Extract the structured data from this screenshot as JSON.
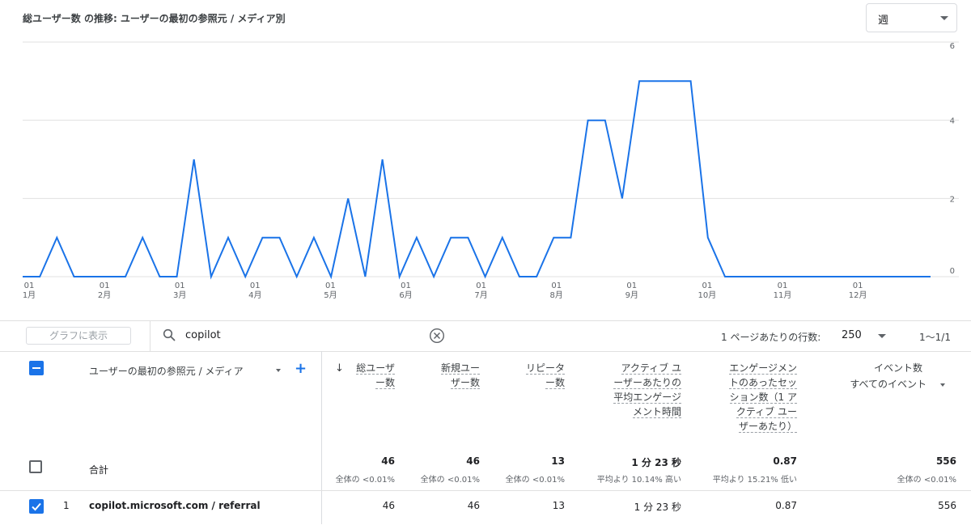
{
  "chart_title": "総ユーザー数 の推移: ユーザーの最初の参照元 / メディア別",
  "period_select": "週",
  "chart_data": {
    "type": "line",
    "y_ticks": [
      "6",
      "4",
      "2",
      "0"
    ],
    "ylim": [
      0,
      6
    ],
    "x_ticks": [
      {
        "day": "01",
        "month": "1月"
      },
      {
        "day": "01",
        "month": "2月"
      },
      {
        "day": "01",
        "month": "3月"
      },
      {
        "day": "01",
        "month": "4月"
      },
      {
        "day": "01",
        "month": "5月"
      },
      {
        "day": "01",
        "month": "6月"
      },
      {
        "day": "01",
        "month": "7月"
      },
      {
        "day": "01",
        "month": "8月"
      },
      {
        "day": "01",
        "month": "9月"
      },
      {
        "day": "01",
        "month": "10月"
      },
      {
        "day": "01",
        "month": "11月"
      },
      {
        "day": "01",
        "month": "12月"
      }
    ],
    "series": [
      {
        "color": "#1a73e8",
        "values": [
          0,
          0,
          1,
          0,
          0,
          0,
          0,
          1,
          0,
          0,
          3,
          0,
          1,
          0,
          1,
          1,
          0,
          1,
          0,
          2,
          0,
          3,
          0,
          1,
          0,
          1,
          1,
          0,
          1,
          0,
          0,
          1,
          1,
          4,
          4,
          2,
          5,
          5,
          5,
          5,
          1,
          0,
          0,
          0,
          0,
          0,
          0,
          0,
          0,
          0,
          0,
          0,
          0,
          0
        ]
      }
    ]
  },
  "graph_button": "グラフに表示",
  "search": {
    "value": "copilot"
  },
  "rows_per_page_label": "1 ページあたりの行数:",
  "rows_per_page": "250",
  "page_range": "1〜1/1",
  "table": {
    "dimension_header": "ユーザーの最初の参照元 / メディア",
    "sort_arrow": "↓",
    "metrics": [
      {
        "lines": [
          "総ユーザ",
          "ー数"
        ]
      },
      {
        "lines": [
          "新規ユー",
          "ザー数"
        ]
      },
      {
        "lines": [
          "リピータ",
          "ー数"
        ]
      },
      {
        "lines": [
          "アクティブ ユ",
          "ーザーあたりの",
          "平均エンゲージ",
          "メント時間"
        ]
      },
      {
        "lines": [
          "エンゲージメン",
          "トのあったセッ",
          "ション数（1 ア",
          "クティブ ユー",
          "ザーあたり）"
        ]
      },
      {
        "lines": [
          "イベント数",
          "すべてのイベント"
        ]
      }
    ],
    "totals_label": "合計",
    "totals": [
      {
        "value": "46",
        "sub": "全体の <0.01%"
      },
      {
        "value": "46",
        "sub": "全体の <0.01%"
      },
      {
        "value": "13",
        "sub": "全体の <0.01%"
      },
      {
        "value": "1 分 23 秒",
        "sub": "平均より 10.14% 高い"
      },
      {
        "value": "0.87",
        "sub": "平均より 15.21% 低い"
      },
      {
        "value": "556",
        "sub": "全体の <0.01%"
      }
    ],
    "rows": [
      {
        "index": "1",
        "name": "copilot.microsoft.com / referral",
        "values": [
          "46",
          "46",
          "13",
          "1 分 23 秒",
          "0.87",
          "556"
        ]
      }
    ]
  }
}
